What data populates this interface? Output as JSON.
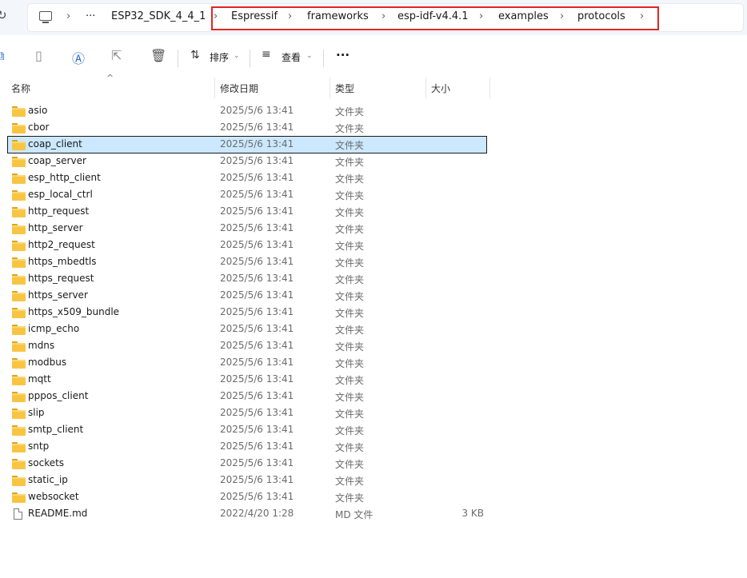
{
  "breadcrumb": {
    "root": "ESP32_SDK_4_4_1",
    "overflow": "···",
    "items": [
      "Espressif",
      "frameworks",
      "esp-idf-v4.4.1",
      "examples",
      "protocols"
    ]
  },
  "toolbar": {
    "sort_label": "排序",
    "view_label": "查看",
    "more": "···"
  },
  "columns": {
    "name": "名称",
    "date": "修改日期",
    "type": "类型",
    "size": "大小"
  },
  "files": [
    {
      "name": "asio",
      "date": "2025/5/6 13:41",
      "type": "文件夹",
      "size": "",
      "kind": "folder"
    },
    {
      "name": "cbor",
      "date": "2025/5/6 13:41",
      "type": "文件夹",
      "size": "",
      "kind": "folder"
    },
    {
      "name": "coap_client",
      "date": "2025/5/6 13:41",
      "type": "文件夹",
      "size": "",
      "kind": "folder",
      "selected": true
    },
    {
      "name": "coap_server",
      "date": "2025/5/6 13:41",
      "type": "文件夹",
      "size": "",
      "kind": "folder"
    },
    {
      "name": "esp_http_client",
      "date": "2025/5/6 13:41",
      "type": "文件夹",
      "size": "",
      "kind": "folder"
    },
    {
      "name": "esp_local_ctrl",
      "date": "2025/5/6 13:41",
      "type": "文件夹",
      "size": "",
      "kind": "folder"
    },
    {
      "name": "http_request",
      "date": "2025/5/6 13:41",
      "type": "文件夹",
      "size": "",
      "kind": "folder"
    },
    {
      "name": "http_server",
      "date": "2025/5/6 13:41",
      "type": "文件夹",
      "size": "",
      "kind": "folder"
    },
    {
      "name": "http2_request",
      "date": "2025/5/6 13:41",
      "type": "文件夹",
      "size": "",
      "kind": "folder"
    },
    {
      "name": "https_mbedtls",
      "date": "2025/5/6 13:41",
      "type": "文件夹",
      "size": "",
      "kind": "folder"
    },
    {
      "name": "https_request",
      "date": "2025/5/6 13:41",
      "type": "文件夹",
      "size": "",
      "kind": "folder"
    },
    {
      "name": "https_server",
      "date": "2025/5/6 13:41",
      "type": "文件夹",
      "size": "",
      "kind": "folder"
    },
    {
      "name": "https_x509_bundle",
      "date": "2025/5/6 13:41",
      "type": "文件夹",
      "size": "",
      "kind": "folder"
    },
    {
      "name": "icmp_echo",
      "date": "2025/5/6 13:41",
      "type": "文件夹",
      "size": "",
      "kind": "folder"
    },
    {
      "name": "mdns",
      "date": "2025/5/6 13:41",
      "type": "文件夹",
      "size": "",
      "kind": "folder"
    },
    {
      "name": "modbus",
      "date": "2025/5/6 13:41",
      "type": "文件夹",
      "size": "",
      "kind": "folder"
    },
    {
      "name": "mqtt",
      "date": "2025/5/6 13:41",
      "type": "文件夹",
      "size": "",
      "kind": "folder"
    },
    {
      "name": "pppos_client",
      "date": "2025/5/6 13:41",
      "type": "文件夹",
      "size": "",
      "kind": "folder"
    },
    {
      "name": "slip",
      "date": "2025/5/6 13:41",
      "type": "文件夹",
      "size": "",
      "kind": "folder"
    },
    {
      "name": "smtp_client",
      "date": "2025/5/6 13:41",
      "type": "文件夹",
      "size": "",
      "kind": "folder"
    },
    {
      "name": "sntp",
      "date": "2025/5/6 13:41",
      "type": "文件夹",
      "size": "",
      "kind": "folder"
    },
    {
      "name": "sockets",
      "date": "2025/5/6 13:41",
      "type": "文件夹",
      "size": "",
      "kind": "folder"
    },
    {
      "name": "static_ip",
      "date": "2025/5/6 13:41",
      "type": "文件夹",
      "size": "",
      "kind": "folder"
    },
    {
      "name": "websocket",
      "date": "2025/5/6 13:41",
      "type": "文件夹",
      "size": "",
      "kind": "folder"
    },
    {
      "name": "README.md",
      "date": "2022/4/20 1:28",
      "type": "MD 文件",
      "size": "3 KB",
      "kind": "file"
    }
  ],
  "colors": {
    "selection": "#cce8ff",
    "folder": "#f8c543",
    "highlight_box": "#e02424"
  }
}
